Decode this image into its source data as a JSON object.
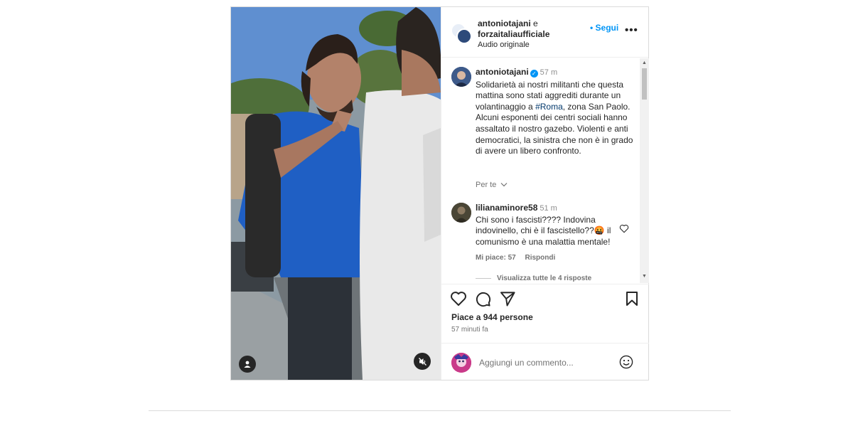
{
  "header": {
    "user1": "antoniotajani",
    "joiner": " e",
    "user2": "forzaitaliaufficiale",
    "audio": "Audio originale",
    "follow": "• Segui",
    "more": "•••"
  },
  "caption": {
    "username": "antoniotajani",
    "time": "57 m",
    "text_before": "Solidarietà ai nostri militanti che questa mattina sono stati aggrediti durante un volantinaggio a ",
    "hashtag": "#Roma",
    "text_after": ", zona San Paolo. Alcuni esponenti dei centri sociali hanno assaltato il nostro gazebo. Violenti e anti democratici, la sinistra che non è in grado di avere un libero confronto.",
    "for_you": "Per te"
  },
  "comment": {
    "username": "lilianaminore58",
    "time": "51 m",
    "text": "Chi sono i fascisti???? Indovina indovinello, chi è il fascistello??🤬 il comunismo è una malattia mentale!",
    "likes": "Mi piace: 57",
    "reply": "Rispondi",
    "view_replies": "Visualizza tutte le 4 risposte"
  },
  "stats": {
    "likes": "Piace a 944 persone",
    "ago": "57 minuti fa"
  },
  "add_comment": {
    "placeholder": "Aggiungi un commento..."
  },
  "icons": {
    "like": "heart-icon",
    "comment": "comment-icon",
    "share": "share-icon",
    "save": "bookmark-icon",
    "mute": "muted-speaker-icon",
    "tag": "user-tag-icon",
    "emoji": "emoji-icon"
  }
}
